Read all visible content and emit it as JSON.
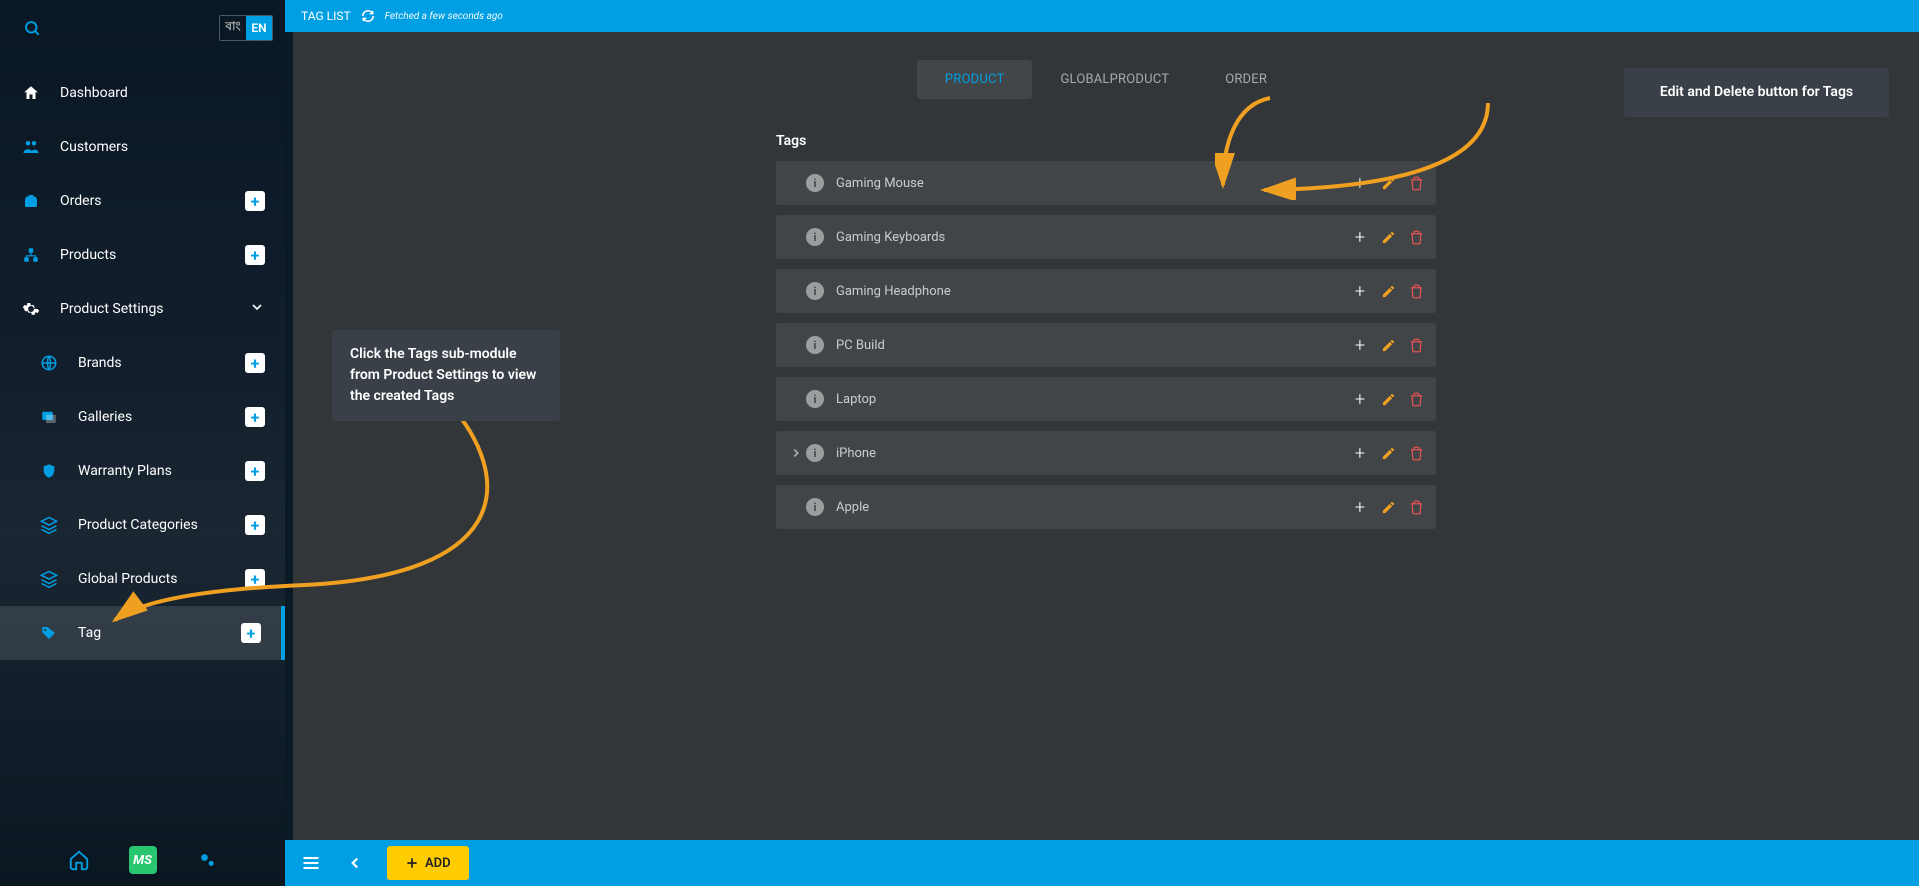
{
  "topbar": {
    "title": "TAG LIST",
    "fetched": "Fetched a few seconds ago"
  },
  "lang": {
    "bn": "বাং",
    "en": "EN"
  },
  "sidebar": {
    "items": [
      {
        "label": "Dashboard"
      },
      {
        "label": "Customers"
      },
      {
        "label": "Orders"
      },
      {
        "label": "Products"
      },
      {
        "label": "Product Settings"
      }
    ],
    "sub": [
      {
        "label": "Brands"
      },
      {
        "label": "Galleries"
      },
      {
        "label": "Warranty Plans"
      },
      {
        "label": "Product Categories"
      },
      {
        "label": "Global Products"
      },
      {
        "label": "Tag"
      }
    ]
  },
  "tabs": {
    "product": "PRODUCT",
    "globalproduct": "GLOBALPRODUCT",
    "order": "ORDER"
  },
  "section": {
    "heading": "Tags"
  },
  "tags": [
    {
      "name": "Gaming Mouse",
      "expandable": false
    },
    {
      "name": "Gaming Keyboards",
      "expandable": false
    },
    {
      "name": "Gaming Headphone",
      "expandable": false
    },
    {
      "name": "PC Build",
      "expandable": false
    },
    {
      "name": "Laptop",
      "expandable": false
    },
    {
      "name": "iPhone",
      "expandable": true
    },
    {
      "name": "Apple",
      "expandable": false
    }
  ],
  "bottombar": {
    "add": "ADD"
  },
  "callouts": {
    "left": "Click the Tags sub-module from Product Settings to view the created Tags",
    "top": "Edit and Delete button for Tags"
  }
}
